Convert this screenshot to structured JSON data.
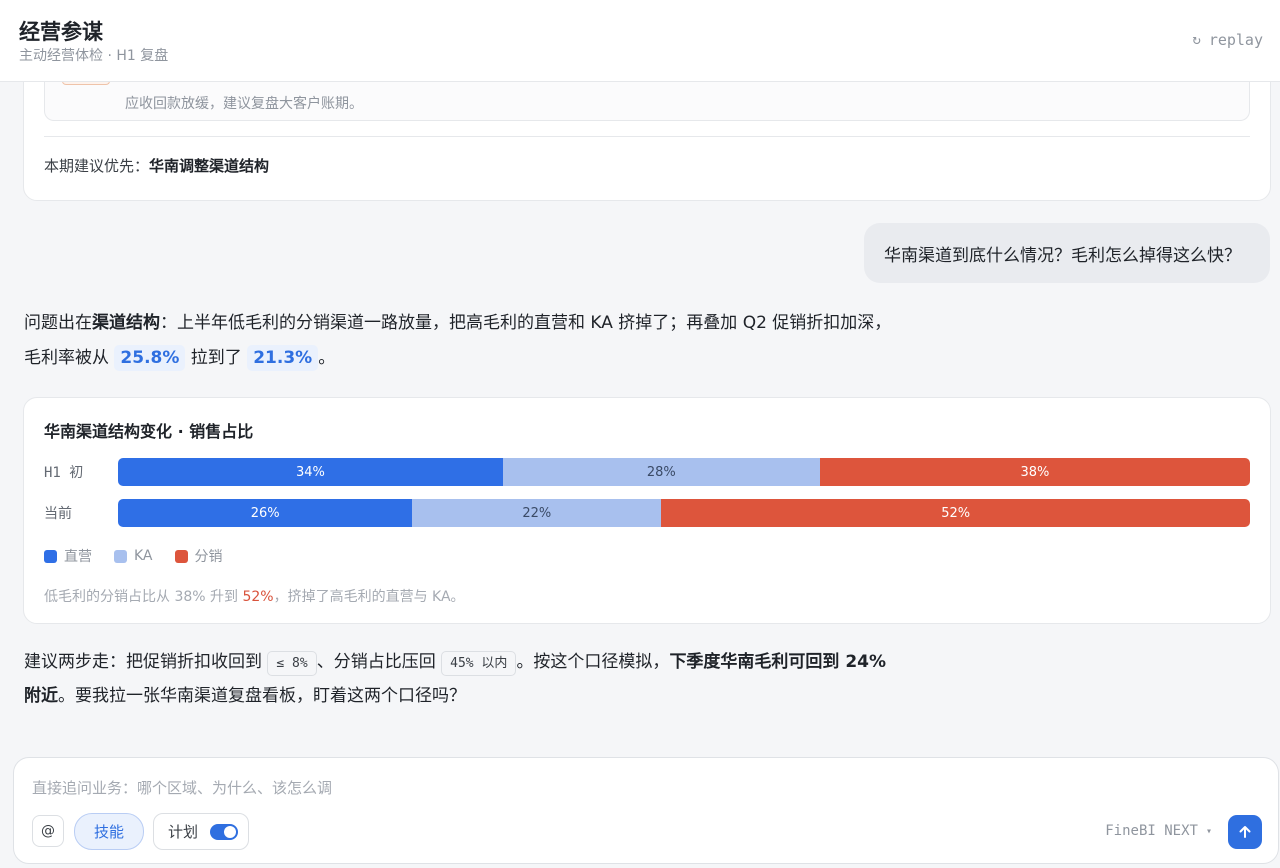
{
  "header": {
    "title": "经营参谋",
    "subtitle": "主动经营体检 · H1 复盘",
    "replay_label": "replay",
    "replay_icon": "↻"
  },
  "previous_card": {
    "note_text": "应收回款放缓，建议复盘大客户账期。",
    "priority_prefix": "本期建议优先：",
    "priority_value": "华南调整渠道结构"
  },
  "user_message": "华南渠道到底什么情况？毛利怎么掉得这么快？",
  "answer_1": {
    "p1_pre": "问题出在",
    "p1_bold": "渠道结构",
    "p1_post": "：上半年低毛利的分销渠道一路放量，把高毛利的直营和 KA 挤掉了；再叠加 Q2 促销折扣加深，",
    "p2_pre": "毛利率被从",
    "rate_from": "25.8%",
    "p2_mid": "拉到了",
    "rate_to": "21.3%",
    "p2_post": "。"
  },
  "chart_data": {
    "type": "bar",
    "stacked": true,
    "orientation": "horizontal",
    "title": "华南渠道结构变化 · 销售占比",
    "categories": [
      "H1 初",
      "当前"
    ],
    "series": [
      {
        "name": "直营",
        "values": [
          34,
          26
        ],
        "color": "#2f6fe6",
        "label_color": "#ffffff"
      },
      {
        "name": "KA",
        "values": [
          28,
          22
        ],
        "color": "#a8c0ee",
        "label_color": "#3a4a66"
      },
      {
        "name": "分销",
        "values": [
          38,
          52
        ],
        "color": "#dd553c",
        "label_color": "#ffffff"
      }
    ],
    "value_suffix": "%",
    "xlim": [
      0,
      100
    ],
    "legend_position": "bottom-left",
    "grid": false,
    "note_pre": "低毛利的分销占比从 38% 升到 ",
    "note_highlight": "52%",
    "note_post": "，挤掉了高毛利的直营与 KA。"
  },
  "answer_2": {
    "t1": "建议两步走：把促销折扣收回到",
    "chip1": "≤ 8%",
    "t2": "、分销占比压回",
    "chip2": "45% 以内",
    "t3": "。按这个口径模拟，",
    "bold1": "下季度华南毛利可回到 24%",
    "bold2": "附近",
    "t4": "。要我拉一张华南渠道复盘看板，盯着这两个口径吗？"
  },
  "composer": {
    "placeholder": "直接追问业务：哪个区域、为什么、该怎么调",
    "at_label": "@",
    "skill_label": "技能",
    "plan_label": "计划",
    "plan_enabled": true,
    "model_label": "FineBI NEXT",
    "model_caret": "▾"
  },
  "colors": {
    "accent": "#2f6fe0",
    "warning": "#d9533c"
  }
}
